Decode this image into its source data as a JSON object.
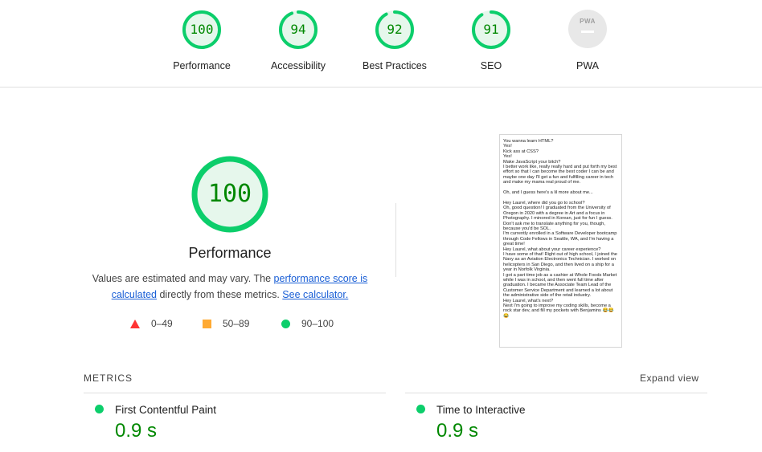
{
  "colors": {
    "pass": "#0cce6b",
    "pass_text": "#008800",
    "average": "#ffaa33",
    "fail": "#ff3333",
    "link": "#1a5fd6"
  },
  "categories": [
    {
      "label": "Performance",
      "score": "100",
      "fraction": 1.0
    },
    {
      "label": "Accessibility",
      "score": "94",
      "fraction": 0.94
    },
    {
      "label": "Best Practices",
      "score": "92",
      "fraction": 0.92
    },
    {
      "label": "SEO",
      "score": "91",
      "fraction": 0.91
    }
  ],
  "pwa": {
    "label": "PWA",
    "badge_text": "PWA"
  },
  "main": {
    "score": "100",
    "fraction": 1.0,
    "title": "Performance",
    "desc_before": "Values are estimated and may vary. The ",
    "desc_link": "performance score is calculated",
    "desc_middle": " directly from these metrics. ",
    "desc_calc_link": "See calculator."
  },
  "legend": [
    {
      "range": "0–49",
      "icon": "triangle-icon"
    },
    {
      "range": "50–89",
      "icon": "square-icon"
    },
    {
      "range": "90–100",
      "icon": "circle-icon"
    }
  ],
  "screenshot_text": "You wanna learn HTML?\nYes!\nKick ass at CSS?\nYes!\nMake JavaScript your bitch?\nI better work like, really really hard and put forth my best effort so that I can become the best coder I can be and maybe one day I'll get a fun and fulfilling career in tech and make my mama real proud of me.\n\nOh, and I guess here's a lil more about me...\n\nHey Laurel, where did you go to school?\nOh, good question! I graduated from the University of Oregon in 2020 with a degree in Art and a focus in Photography. I minored in Korean, just for fun I guess. Don't ask me to translate anything for you, though, because you'd be SOL.\nI'm currently enrolled in a Software Developer bootcamp through Code Fellows in Seattle, WA, and I'm having a great time!\nHey Laurel, what about your career experience?\nI have some of that! Right out of high school, I joined the Navy as an Aviation Electronics Technician. I worked on helicopters in San Diego, and then lived on a ship for a year in Norfolk Virginia.\nI got a part time job as a cashier at Whole Foods Market while I was in school, and then went full time after graduation. I became the Associate Team Lead of the Customer Service Department and learned a lot about the administrative side of the retail industry.\nHey Laurel, what's next?\nNext I'm going to improve my coding skills, become a rock star dev, and fill my pockets with Benjamins 😂😂😂",
  "metrics": {
    "heading": "METRICS",
    "expand_label": "Expand view",
    "items": [
      {
        "name": "First Contentful Paint",
        "value": "0.9 s"
      },
      {
        "name": "Time to Interactive",
        "value": "0.9 s"
      }
    ]
  }
}
